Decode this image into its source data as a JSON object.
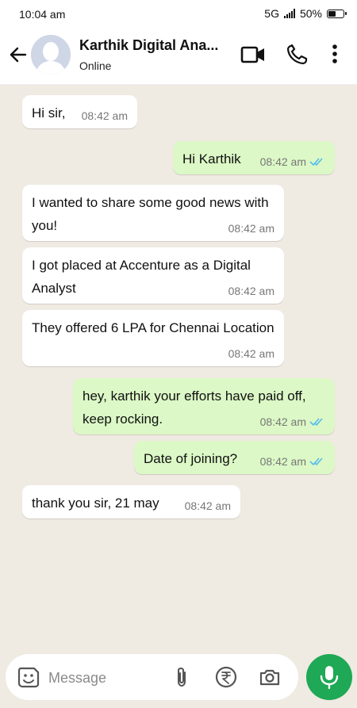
{
  "status_bar": {
    "time": "10:04 am",
    "network": "5G",
    "battery": "50%",
    "battery_level": 0.5
  },
  "header": {
    "contact_name": "Karthik Digital Ana...",
    "status": "Online"
  },
  "messages": [
    {
      "dir": "in",
      "text": "Hi sir,",
      "time": "08:42 am"
    },
    {
      "dir": "out",
      "text": "Hi Karthik",
      "time": "08:42 am"
    },
    {
      "dir": "in",
      "text": "I wanted to share some good news with you!",
      "time": "08:42 am"
    },
    {
      "dir": "in",
      "text": "I got placed at Accenture as a Digital Analyst",
      "time": "08:42 am"
    },
    {
      "dir": "in",
      "text": "They offered 6 LPA for Chennai Location",
      "time": "08:42 am"
    },
    {
      "dir": "out",
      "text": "hey, karthik your efforts have paid off, keep rocking.",
      "time": "08:42 am"
    },
    {
      "dir": "out",
      "text": "Date of joining?",
      "time": "08:42 am"
    },
    {
      "dir": "in",
      "text": "thank you sir, 21 may",
      "time": "08:42 am"
    }
  ],
  "composer": {
    "placeholder": "Message"
  },
  "colors": {
    "incoming": "#ffffff",
    "outgoing": "#dcf8c6",
    "accent": "#1fa855",
    "read_ticks": "#53bdeb"
  },
  "icons": [
    "back-arrow-icon",
    "video-call-icon",
    "phone-icon",
    "more-options-icon",
    "sticker-icon",
    "attach-icon",
    "rupee-payment-icon",
    "camera-icon",
    "mic-icon"
  ]
}
